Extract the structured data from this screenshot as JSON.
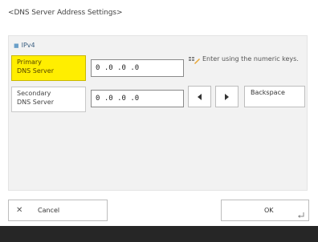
{
  "screen": {
    "title": "<DNS Server Address Settings>"
  },
  "section": {
    "header": "IPv4",
    "icon": "bullet-dot"
  },
  "fields": {
    "primary": {
      "label": "Primary\nDNS Server",
      "value": "0 .0 .0 .0",
      "selected": true
    },
    "secondary": {
      "label": "Secondary\nDNS Server",
      "value": "0 .0 .0 .0",
      "selected": false
    }
  },
  "hint": {
    "icon": "numeric-keypad-icon",
    "text": "Enter using the numeric keys."
  },
  "keys": {
    "left_icon": "arrow-left-icon",
    "right_icon": "arrow-right-icon",
    "backspace_label": "Backspace"
  },
  "actions": {
    "cancel_label": "Cancel",
    "cancel_icon": "close-icon",
    "ok_label": "OK",
    "ok_icon": "enter-icon"
  },
  "colors": {
    "selected_field": "#ffee00",
    "panel": "#f2f2f2",
    "footer": "#262626"
  }
}
